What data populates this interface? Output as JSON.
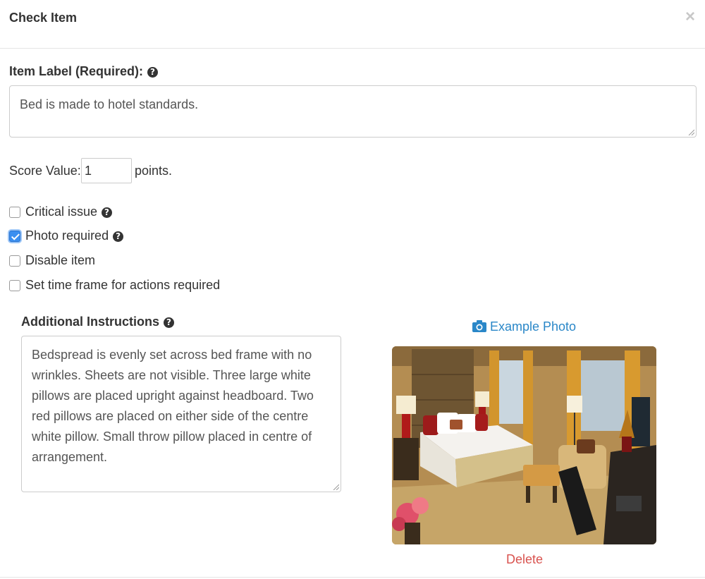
{
  "modal": {
    "title": "Check Item",
    "close_symbol": "×"
  },
  "item_label": {
    "label": "Item Label (Required):",
    "value": "Bed is made to hotel standards."
  },
  "score": {
    "label": "Score Value:",
    "value": "1",
    "unit": "points."
  },
  "options": [
    {
      "label": "Critical issue",
      "checked": false,
      "has_help": true
    },
    {
      "label": "Photo required",
      "checked": true,
      "has_help": true
    },
    {
      "label": "Disable item",
      "checked": false,
      "has_help": false
    },
    {
      "label": "Set time frame for actions required",
      "checked": false,
      "has_help": false
    }
  ],
  "instructions": {
    "label": "Additional Instructions",
    "value": "Bedspread is evenly set across bed frame with no wrinkles. Sheets are not visible. Three large white pillows are placed upright against headboard. Two red pillows are placed on either side of the centre white pillow. Small throw pillow placed in centre of arrangement."
  },
  "example_photo": {
    "link_label": "Example Photo",
    "delete_label": "Delete"
  },
  "icons": {
    "help": "question-circle-icon",
    "camera": "camera-icon",
    "close": "close-icon"
  },
  "colors": {
    "link": "#2a87c8",
    "danger": "#d9534f",
    "checkbox_checked": "#3b8ff0"
  }
}
